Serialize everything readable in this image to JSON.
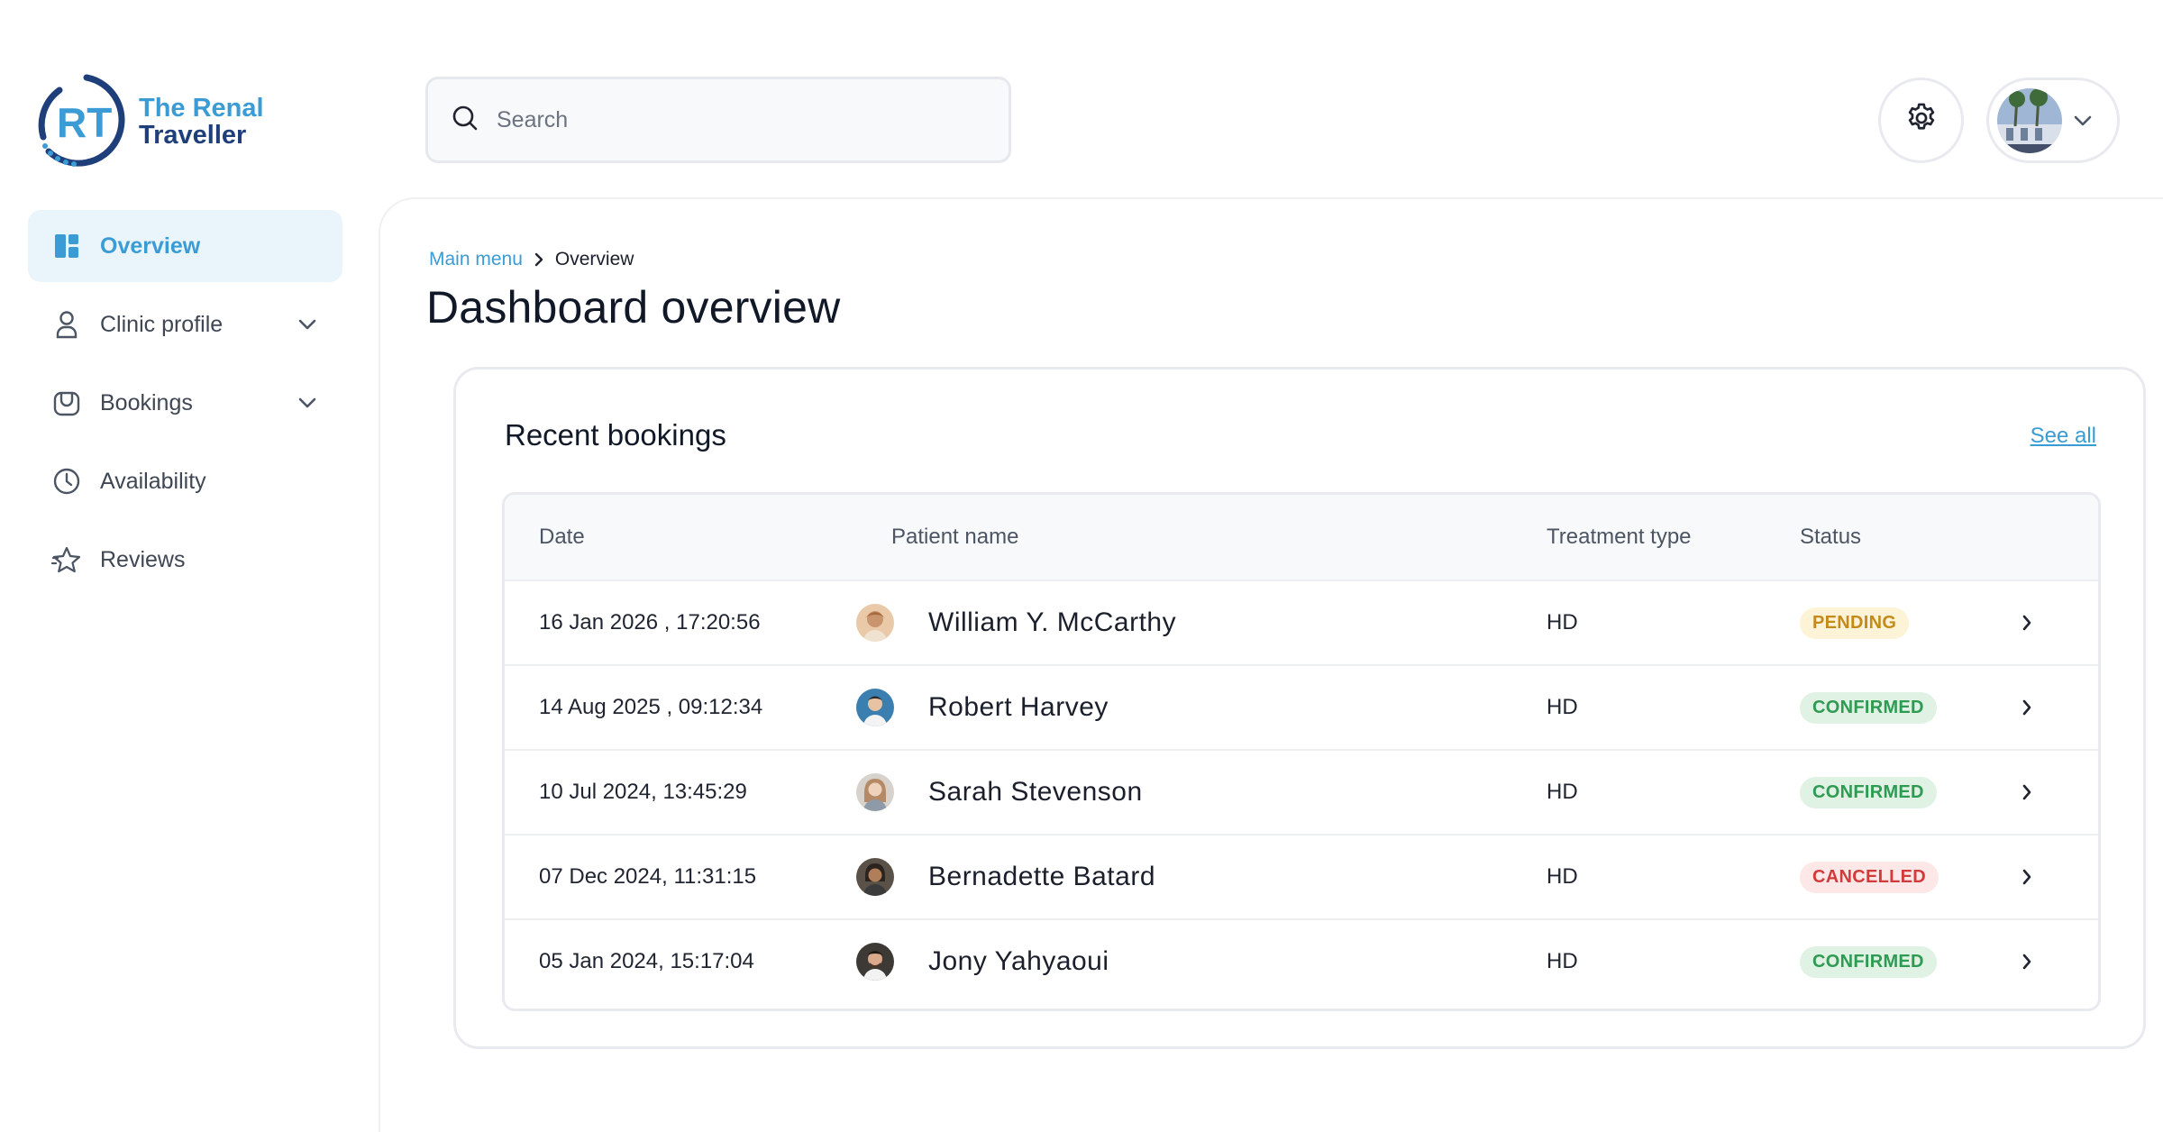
{
  "brand": {
    "name_line1": "The Renal",
    "name_line2": "Traveller",
    "monogram": "RT"
  },
  "sidebar": {
    "items": [
      {
        "label": "Overview",
        "icon": "dashboard-icon",
        "active": true,
        "expandable": false
      },
      {
        "label": "Clinic profile",
        "icon": "person-icon",
        "active": false,
        "expandable": true
      },
      {
        "label": "Bookings",
        "icon": "bag-icon",
        "active": false,
        "expandable": true
      },
      {
        "label": "Availability",
        "icon": "clock-icon",
        "active": false,
        "expandable": false
      },
      {
        "label": "Reviews",
        "icon": "star-icon",
        "active": false,
        "expandable": false
      }
    ]
  },
  "header": {
    "search_placeholder": "Search",
    "settings_icon": "gear-icon",
    "profile_icon": "chevron-down-icon"
  },
  "breadcrumb": {
    "parent": "Main menu",
    "current": "Overview"
  },
  "page_title": "Dashboard overview",
  "recent_bookings": {
    "title": "Recent bookings",
    "see_all": "See all",
    "columns": {
      "date": "Date",
      "patient": "Patient name",
      "treatment": "Treatment type",
      "status": "Status"
    },
    "rows": [
      {
        "date": "16 Jan 2026 , 17:20:56",
        "patient": "William Y. McCarthy",
        "treatment": "HD",
        "status": "PENDING"
      },
      {
        "date": "14 Aug 2025 , 09:12:34",
        "patient": "Robert Harvey",
        "treatment": "HD",
        "status": "CONFIRMED"
      },
      {
        "date": "10 Jul 2024, 13:45:29",
        "patient": "Sarah Stevenson",
        "treatment": "HD",
        "status": "CONFIRMED"
      },
      {
        "date": "07 Dec 2024, 11:31:15",
        "patient": "Bernadette Batard",
        "treatment": "HD",
        "status": "CANCELLED"
      },
      {
        "date": "05 Jan 2024, 15:17:04",
        "patient": "Jony Yahyaoui",
        "treatment": "HD",
        "status": "CONFIRMED"
      }
    ]
  },
  "colors": {
    "accent": "#3b9bd4",
    "brand_dark": "#1f3f7a",
    "pending": "#c48a1c",
    "confirmed": "#2f9b52",
    "cancelled": "#d23b3b"
  }
}
